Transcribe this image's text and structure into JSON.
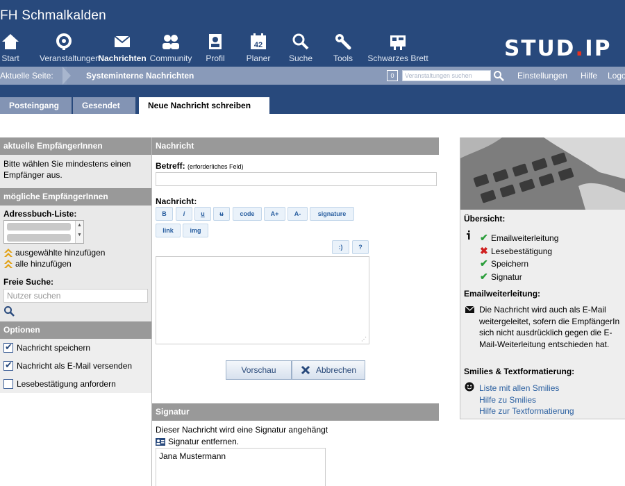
{
  "header": {
    "site_title": "FH Schmalkalden",
    "logo_main": "STUD",
    "logo_dot": ".",
    "logo_end": "IP",
    "nav": [
      {
        "label": "Start",
        "icon": "home-icon"
      },
      {
        "label": "Veranstaltungen",
        "icon": "courses-icon"
      },
      {
        "label": "Nachrichten",
        "icon": "envelope-icon"
      },
      {
        "label": "Community",
        "icon": "community-icon"
      },
      {
        "label": "Profil",
        "icon": "profile-icon"
      },
      {
        "label": "Planer",
        "icon": "calendar-icon",
        "badge": "42"
      },
      {
        "label": "Suche",
        "icon": "search-icon"
      },
      {
        "label": "Tools",
        "icon": "wrench-icon"
      },
      {
        "label": "Schwarzes Brett",
        "icon": "board-icon"
      }
    ]
  },
  "crumbbar": {
    "label": "Aktuelle Seite:",
    "current": "Systeminterne Nachrichten",
    "count": "0",
    "search_placeholder": "Veranstaltungen suchen",
    "links": {
      "settings": "Einstellungen",
      "help": "Hilfe",
      "logout": "Logout"
    }
  },
  "tabs": {
    "inbox": "Posteingang",
    "sent": "Gesendet",
    "compose": "Neue Nachricht schreiben"
  },
  "left": {
    "current_head": "aktuelle EmpfängerInnen",
    "current_text": "Bitte wählen Sie mindestens einen Empfänger aus.",
    "possible_head": "mögliche EmpfängerInnen",
    "addressbook_label": "Adressbuch-Liste:",
    "add_selected": "ausgewählte hinzufügen",
    "add_all": "alle hinzufügen",
    "free_search_label": "Freie Suche:",
    "user_search_placeholder": "Nutzer suchen",
    "options_head": "Optionen",
    "options": [
      {
        "label": "Nachricht speichern",
        "checked": true
      },
      {
        "label": "Nachricht als E-Mail versenden",
        "checked": true
      },
      {
        "label": "Lesebestätigung anfordern",
        "checked": false
      }
    ]
  },
  "message": {
    "head": "Nachricht",
    "subject_label": "Betreff:",
    "required_note": "(erforderliches Feld)",
    "body_label": "Nachricht:",
    "format_buttons": {
      "bold": "B",
      "italic": "i",
      "underline": "u",
      "strike": "u",
      "code": "code",
      "bigger": "A+",
      "smaller": "A-",
      "signature": "signature",
      "link": "link",
      "img": "img",
      "smiley": ":)",
      "help": "?"
    },
    "preview_label": "Vorschau",
    "cancel_label": "Abbrechen",
    "signature_head": "Signatur",
    "signature_note": "Dieser Nachricht wird eine Signatur angehängt",
    "signature_remove": "Signatur entfernen.",
    "signature_text": "Jana Mustermann"
  },
  "sidebar": {
    "overview_title": "Übersicht:",
    "overview": [
      {
        "label": "Emailweiterleitung",
        "status": "ok"
      },
      {
        "label": "Lesebestätigung",
        "status": "no"
      },
      {
        "label": "Speichern",
        "status": "ok"
      },
      {
        "label": "Signatur",
        "status": "ok"
      }
    ],
    "forward_title": "Emailweiterleitung:",
    "forward_text": "Die Nachricht wird auch als E-Mail weitergeleitet, sofern die EmpfängerIn sich nicht ausdrücklich gegen die E-Mail-Weiterleitung entschieden hat.",
    "smilies_title": "Smilies & Textformatierung:",
    "smilies_links": [
      "Liste mit allen Smilies",
      "Hilfe zu Smilies",
      "Hilfe zur Textformatierung"
    ]
  }
}
